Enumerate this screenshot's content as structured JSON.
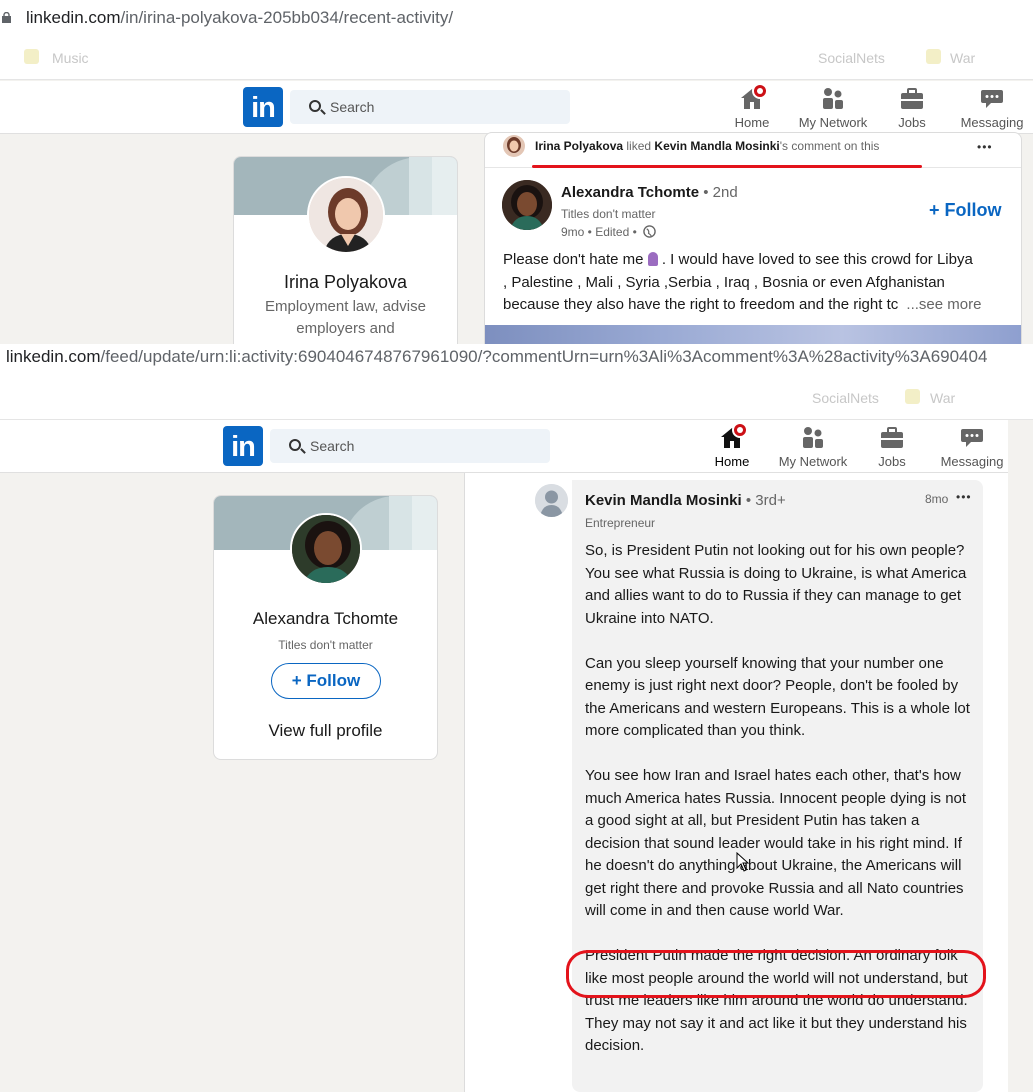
{
  "top": {
    "url_domain": "linkedin.com",
    "url_path": "/in/irina-polyakova-205bb034/recent-activity/",
    "bookmarks": [
      "Music",
      "SocialNets",
      "War"
    ],
    "search_placeholder": "Search",
    "nav": [
      "Home",
      "My Network",
      "Jobs",
      "Messaging"
    ],
    "profile": {
      "name": "Irina Polyakova",
      "headline_line1": "Employment law, advise",
      "headline_line2": "employers and"
    },
    "activity": {
      "actor": "Irina Polyakova",
      "verb": " liked ",
      "target": "Kevin Mandla Mosinki",
      "suffix": "'s comment on this",
      "more": "•••"
    },
    "post": {
      "author": "Alexandra Tchomte",
      "degree": " • 2nd",
      "headline": "Titles don't matter",
      "meta": "9mo • Edited •",
      "follow": "Follow",
      "text_line1_a": "Please don't hate me",
      "text_line1_b": ". I would have loved to see this crowd for Libya",
      "text_line2": ", Palestine , Mali , Syria ,Serbia , Iraq , Bosnia or even Afghanistan",
      "text_line3": "because they also have the right to freedom and the right tc",
      "see_more": "...see more"
    }
  },
  "bottom": {
    "url_domain": "linkedin.com",
    "url_path": "/feed/update/urn:li:activity:6904046748767961090/?commentUrn=urn%3Ali%3Acomment%3A%28activity%3A690404",
    "bookmarks": [
      "SocialNets",
      "War"
    ],
    "search_placeholder": "Search",
    "nav": [
      "Home",
      "My Network",
      "Jobs",
      "Messaging"
    ],
    "profile": {
      "name": "Alexandra Tchomte",
      "headline": "Titles don't matter",
      "follow": "Follow",
      "view_profile": "View full profile"
    },
    "comment": {
      "author": "Kevin Mandla Mosinki",
      "degree": " • 3rd+",
      "headline": "Entrepreneur",
      "time": "8mo",
      "more": "•••",
      "p1": "So, is President Putin not looking out for his own people? You see what Russia is doing to Ukraine, is what America and allies want to do to Russia if they can manage to get Ukraine into NATO.",
      "p2": "Can you sleep yourself knowing that your number one enemy is just right next door? People, don't be fooled by the Americans and western Europeans. This is a whole lot more complicated than you think.",
      "p3": "You see how Iran and Israel hates each other, that's how much America hates Russia. Innocent people dying is not a good sight at all, but President Putin has taken a decision that sound leader would take in his right mind. If he doesn't do anything about Ukraine, the Americans will get right there and provoke Russia and all Nato countries will come in and then cause world War.",
      "p4": "President Putin made the right decision. An ordinary folk like most people around the world will not understand, but trust me leaders like him around the world do understand. They may not say it and act like it but they understand his decision."
    }
  },
  "colors": {
    "brand": "#0a66c2",
    "annotation": "#e3131b",
    "badge": "#cc1016"
  }
}
